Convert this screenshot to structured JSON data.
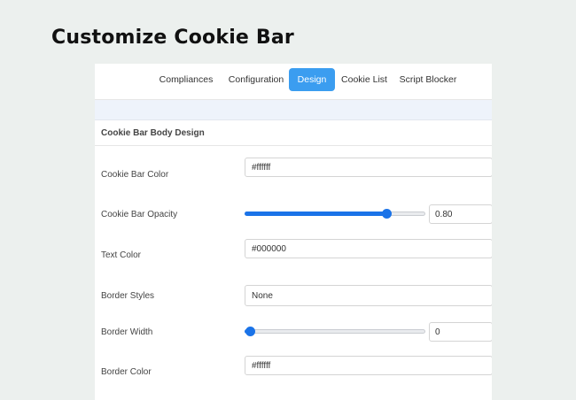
{
  "page_title": "Customize Cookie Bar",
  "tabs": [
    {
      "label": "Compliances",
      "active": false
    },
    {
      "label": "Configuration",
      "active": false
    },
    {
      "label": "Design",
      "active": true
    },
    {
      "label": "Cookie List",
      "active": false
    },
    {
      "label": "Script Blocker",
      "active": false
    }
  ],
  "section_title": "Cookie Bar Body Design",
  "fields": {
    "bar_color": {
      "label": "Cookie Bar Color",
      "value": "#ffffff"
    },
    "bar_opacity": {
      "label": "Cookie Bar Opacity",
      "value": "0.80",
      "fraction": 0.8
    },
    "text_color": {
      "label": "Text Color",
      "value": "#000000"
    },
    "border_styles": {
      "label": "Border Styles",
      "value": "None"
    },
    "border_width": {
      "label": "Border Width",
      "value": "0",
      "fraction": 0
    },
    "border_color": {
      "label": "Border Color",
      "value": "#ffffff"
    }
  },
  "colors": {
    "accent": "#3b9df0",
    "slider": "#1a73e8",
    "background": "#ecf0ee"
  }
}
